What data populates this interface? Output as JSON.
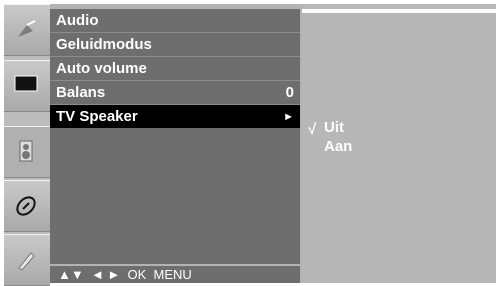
{
  "menu": {
    "title": "Audio",
    "items": [
      {
        "label": "Geluidmodus",
        "value": ""
      },
      {
        "label": "Auto volume",
        "value": ""
      },
      {
        "label": "Balans",
        "value": "0"
      },
      {
        "label": "TV Speaker",
        "value": "",
        "arrow": "►"
      }
    ],
    "footer": "▲▼  ◄ ►  OK  MENU"
  },
  "submenu": {
    "check": "√",
    "options": [
      "Uit",
      "Aan"
    ]
  },
  "icons": [
    "satellite-dish-icon",
    "screen-icon",
    "speaker-icon",
    "clock-icon",
    "settings-wand-icon"
  ],
  "colors": {
    "panel": "#6e6e6e",
    "selected": "#000000",
    "background": "#b7b7b7",
    "text": "#ffffff"
  }
}
